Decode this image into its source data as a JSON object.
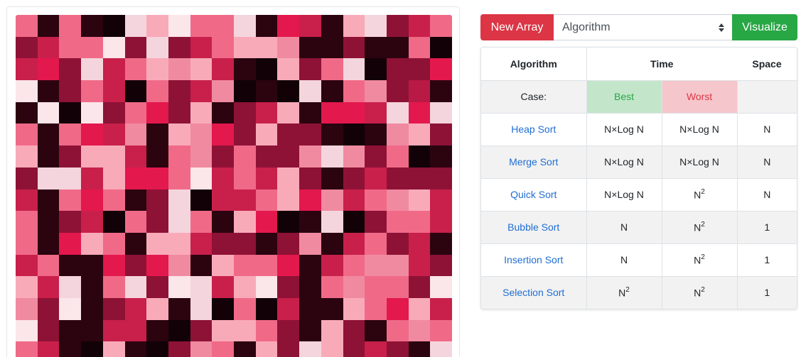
{
  "controls": {
    "new_array_label": "New Array",
    "algorithm_select_value": "Algorithm",
    "visualize_label": "Visualize"
  },
  "table": {
    "headers": {
      "algorithm": "Algorithm",
      "time": "Time",
      "space": "Space"
    },
    "case_row": {
      "label": "Case:",
      "best": "Best",
      "worst": "Worst"
    },
    "rows": [
      {
        "name": "Heap Sort",
        "best": "N×Log N",
        "worst": "N×Log N",
        "space": "N"
      },
      {
        "name": "Merge Sort",
        "best": "N×Log N",
        "worst": "N×Log N",
        "space": "N"
      },
      {
        "name": "Quick Sort",
        "best": "N×Log N",
        "worst": "N",
        "worst_sup": "2",
        "space": "N"
      },
      {
        "name": "Bubble Sort",
        "best": "N",
        "worst": "N",
        "worst_sup": "2",
        "space": "1"
      },
      {
        "name": "Insertion Sort",
        "best": "N",
        "worst": "N",
        "worst_sup": "2",
        "space": "1"
      },
      {
        "name": "Selection Sort",
        "best": "N",
        "best_sup": "2",
        "worst": "N",
        "worst_sup": "2",
        "space": "1"
      }
    ]
  },
  "heatmap": {
    "palette": [
      "#5c0a1e",
      "#2b0410",
      "#f5d5dd",
      "#f06a88",
      "#c8204a",
      "#8e1236",
      "#f9aab9",
      "#e3184d",
      "#120208",
      "#fbe6ea",
      "#b81a45",
      "#f08aa0"
    ],
    "cells": [
      3,
      1,
      3,
      1,
      8,
      2,
      6,
      9,
      3,
      3,
      2,
      1,
      7,
      4,
      1,
      6,
      2,
      5,
      4,
      3,
      5,
      4,
      3,
      3,
      9,
      5,
      2,
      5,
      4,
      3,
      6,
      6,
      11,
      1,
      1,
      5,
      1,
      1,
      3,
      8,
      4,
      7,
      5,
      2,
      4,
      3,
      6,
      11,
      6,
      4,
      1,
      8,
      6,
      5,
      3,
      2,
      8,
      5,
      5,
      7,
      9,
      1,
      5,
      3,
      4,
      8,
      3,
      5,
      4,
      11,
      8,
      1,
      8,
      2,
      1,
      3,
      11,
      5,
      10,
      1,
      1,
      9,
      8,
      9,
      5,
      3,
      7,
      5,
      6,
      1,
      5,
      4,
      6,
      1,
      7,
      7,
      4,
      2,
      7,
      2,
      3,
      1,
      3,
      7,
      4,
      11,
      1,
      6,
      11,
      7,
      5,
      6,
      5,
      5,
      1,
      8,
      1,
      11,
      6,
      5,
      6,
      1,
      5,
      6,
      6,
      4,
      1,
      3,
      11,
      5,
      3,
      5,
      5,
      11,
      2,
      11,
      5,
      3,
      8,
      1,
      5,
      2,
      2,
      4,
      6,
      7,
      7,
      3,
      9,
      4,
      3,
      4,
      6,
      5,
      1,
      5,
      4,
      5,
      5,
      5,
      4,
      1,
      3,
      7,
      3,
      1,
      5,
      2,
      8,
      4,
      4,
      3,
      6,
      7,
      11,
      4,
      3,
      11,
      6,
      4,
      3,
      1,
      5,
      4,
      8,
      3,
      5,
      2,
      3,
      1,
      6,
      7,
      8,
      1,
      2,
      8,
      5,
      3,
      3,
      4,
      3,
      1,
      7,
      6,
      3,
      1,
      6,
      6,
      4,
      5,
      5,
      1,
      5,
      11,
      1,
      4,
      3,
      5,
      4,
      1,
      4,
      3,
      1,
      1,
      7,
      5,
      7,
      11,
      1,
      6,
      3,
      3,
      7,
      1,
      4,
      3,
      11,
      11,
      4,
      5,
      6,
      4,
      2,
      1,
      3,
      2,
      5,
      9,
      2,
      4,
      6,
      9,
      5,
      1,
      3,
      11,
      3,
      3,
      5,
      9,
      11,
      5,
      9,
      1,
      5,
      4,
      6,
      1,
      2,
      8,
      3,
      8,
      4,
      1,
      1,
      6,
      3,
      7,
      6,
      4,
      9,
      5,
      1,
      1,
      4,
      4,
      1,
      8,
      5,
      6,
      6,
      3,
      5,
      1,
      6,
      5,
      1,
      3,
      11,
      3,
      3,
      4,
      1,
      8,
      6,
      1,
      8,
      5,
      11,
      3,
      1,
      6,
      5,
      2,
      6,
      5,
      4,
      5,
      1,
      2
    ]
  }
}
